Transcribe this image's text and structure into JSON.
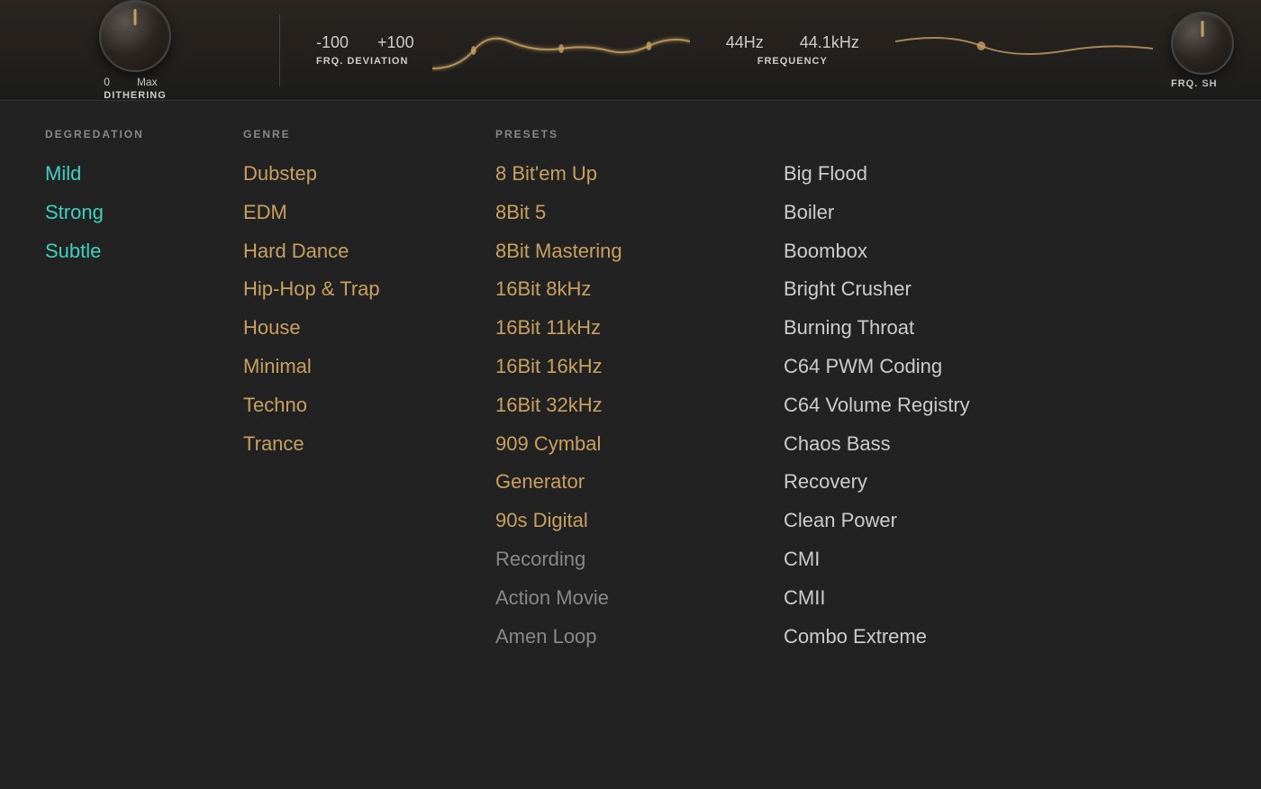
{
  "instrument_bar": {
    "knob_dithering": {
      "label_min": "0",
      "label_max": "Max",
      "name": "DITHERING"
    },
    "frq_deviation": {
      "label_min": "-100",
      "label_max": "+100",
      "name": "FRQ. DEVIATION"
    },
    "frequency": {
      "hz_value": "44Hz",
      "khz_value": "44.1kHz",
      "name": "FREQUENCY"
    },
    "frq_sh": {
      "name": "FRQ. SH"
    }
  },
  "degradation": {
    "header": "DEGREDATION",
    "items": [
      {
        "label": "Mild",
        "style": "cyan"
      },
      {
        "label": "Strong",
        "style": "cyan"
      },
      {
        "label": "Subtle",
        "style": "cyan"
      }
    ]
  },
  "genre": {
    "header": "GENRE",
    "items": [
      {
        "label": "Dubstep",
        "style": "orange"
      },
      {
        "label": "EDM",
        "style": "orange"
      },
      {
        "label": "Hard Dance",
        "style": "orange"
      },
      {
        "label": "Hip-Hop & Trap",
        "style": "orange"
      },
      {
        "label": "House",
        "style": "orange"
      },
      {
        "label": "Minimal",
        "style": "orange"
      },
      {
        "label": "Techno",
        "style": "orange"
      },
      {
        "label": "Trance",
        "style": "orange"
      }
    ]
  },
  "presets": {
    "header": "PRESETS",
    "left_column": [
      {
        "label": "8 Bit'em Up",
        "style": "orange"
      },
      {
        "label": "8Bit 5",
        "style": "orange"
      },
      {
        "label": "8Bit Mastering",
        "style": "orange"
      },
      {
        "label": "16Bit 8kHz",
        "style": "orange"
      },
      {
        "label": "16Bit 11kHz",
        "style": "orange"
      },
      {
        "label": "16Bit 16kHz",
        "style": "orange"
      },
      {
        "label": "16Bit 32kHz",
        "style": "orange"
      },
      {
        "label": "909 Cymbal",
        "style": "orange"
      },
      {
        "label": "Generator",
        "style": "orange"
      },
      {
        "label": "90s Digital",
        "style": "orange"
      },
      {
        "label": "Recording",
        "style": "muted"
      },
      {
        "label": "Action Movie",
        "style": "muted"
      },
      {
        "label": "Amen Loop",
        "style": "muted"
      }
    ],
    "right_column": [
      {
        "label": "Big Flood",
        "style": "normal"
      },
      {
        "label": "Boiler",
        "style": "normal"
      },
      {
        "label": "Boombox",
        "style": "normal"
      },
      {
        "label": "Bright Crusher",
        "style": "normal"
      },
      {
        "label": "Burning Throat",
        "style": "normal"
      },
      {
        "label": "C64 PWM Coding",
        "style": "normal"
      },
      {
        "label": "C64 Volume Registry",
        "style": "normal"
      },
      {
        "label": "Chaos Bass",
        "style": "normal"
      },
      {
        "label": "Recovery",
        "style": "normal"
      },
      {
        "label": "Clean Power",
        "style": "normal"
      },
      {
        "label": "CMI",
        "style": "normal"
      },
      {
        "label": "CMII",
        "style": "normal"
      },
      {
        "label": "Combo Extreme",
        "style": "normal"
      }
    ]
  }
}
